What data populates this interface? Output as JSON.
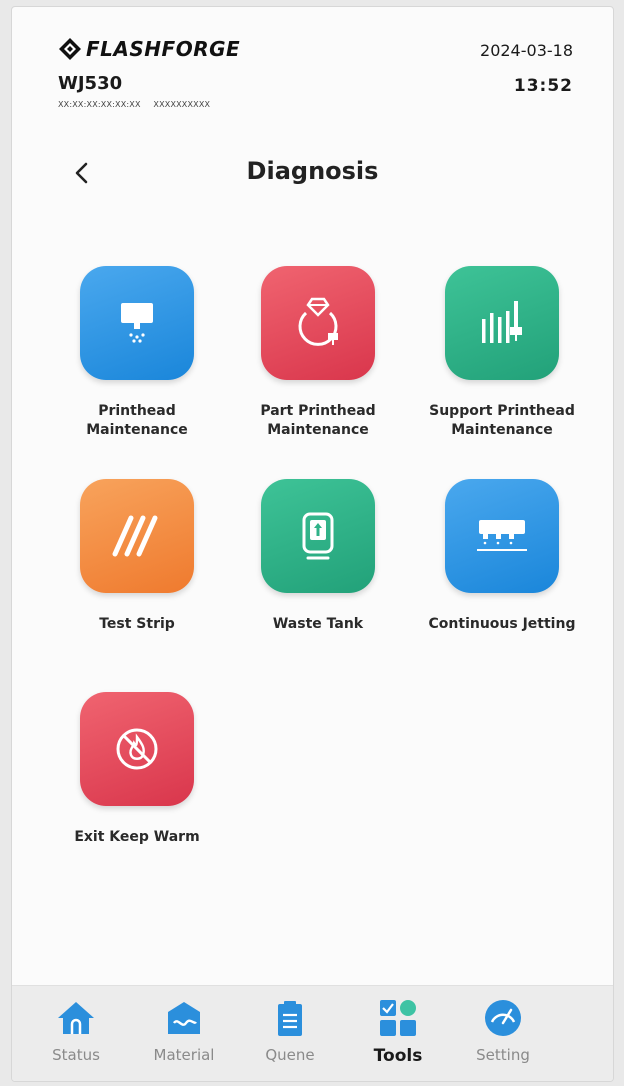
{
  "header": {
    "brand": "FLASHFORGE",
    "model": "WJ530",
    "mac": "XX:XX:XX:XX:XX:XX",
    "serial": "XXXXXXXXXX",
    "date": "2024-03-18",
    "time": "13:52"
  },
  "page": {
    "title": "Diagnosis"
  },
  "tiles": [
    {
      "label_line1": "Printhead",
      "label_line2": "Maintenance",
      "color": "#2b95e3",
      "icon": "printhead-icon"
    },
    {
      "label_line1": "Part Printhead",
      "label_line2": "Maintenance",
      "color": "#e44c5e",
      "icon": "part-printhead-icon"
    },
    {
      "label_line1": "Support Printhead",
      "label_line2": "Maintenance",
      "color": "#2fb288",
      "icon": "support-printhead-icon"
    },
    {
      "label_line1": "Test Strip",
      "color": "#f38b3f",
      "icon": "test-strip-icon"
    },
    {
      "label_line1": "Waste Tank",
      "color": "#2fb288",
      "icon": "waste-tank-icon"
    },
    {
      "label_line1": "Continuous Jetting",
      "color": "#2b95e3",
      "icon": "continuous-jetting-icon"
    },
    {
      "label_line1": "Exit Keep Warm",
      "color": "#e44c5e",
      "icon": "exit-keep-warm-icon"
    }
  ],
  "nav": {
    "items": [
      {
        "label": "Status",
        "icon": "home-icon"
      },
      {
        "label": "Material",
        "icon": "material-icon"
      },
      {
        "label": "Quene",
        "icon": "queue-icon"
      },
      {
        "label": "Tools",
        "icon": "tools-icon",
        "active": true
      },
      {
        "label": "Setting",
        "icon": "gauge-icon"
      }
    ]
  }
}
